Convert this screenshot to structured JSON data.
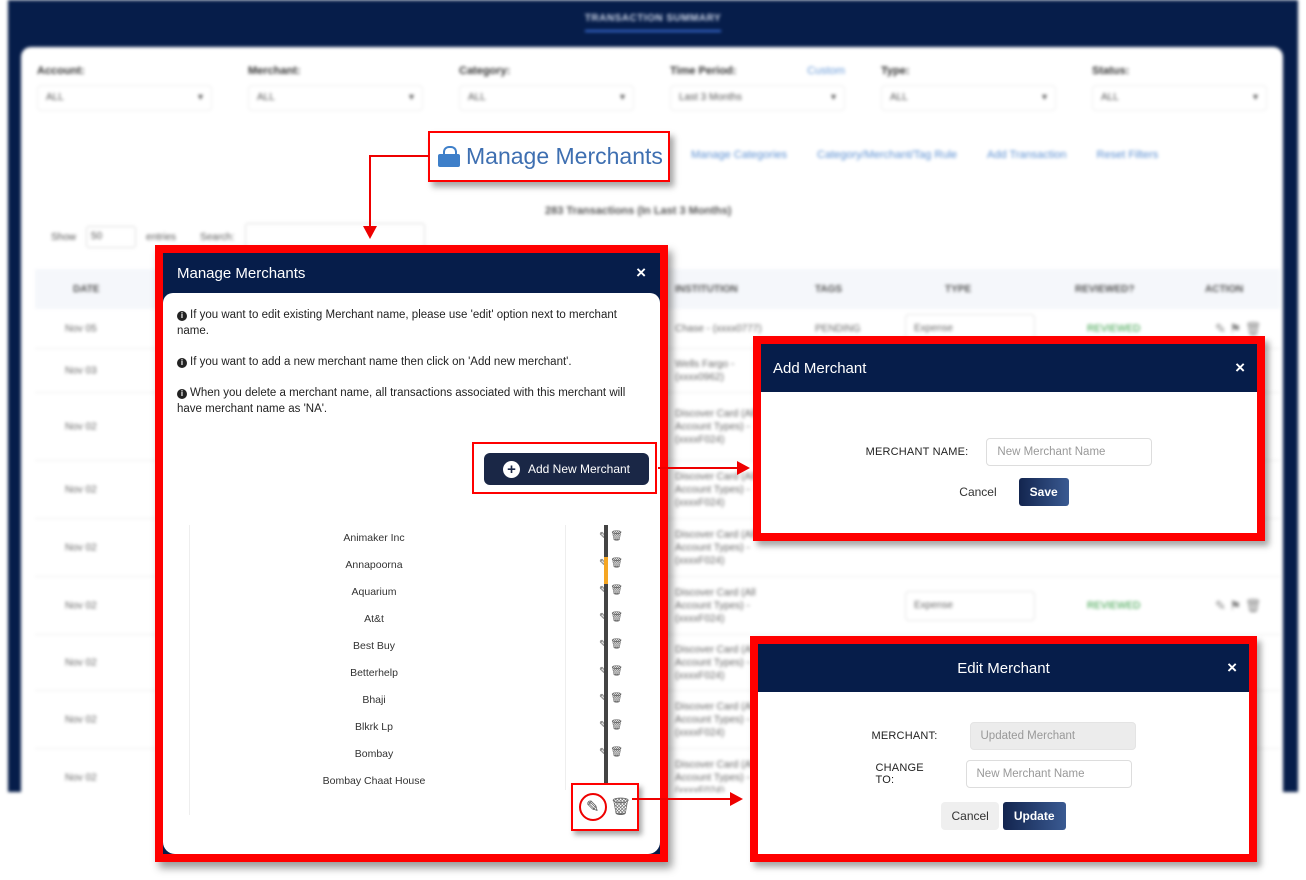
{
  "background": {
    "nav_title": "TRANSACTION SUMMARY",
    "filters": [
      {
        "label": "Account:",
        "value": "ALL"
      },
      {
        "label": "Merchant:",
        "value": "ALL"
      },
      {
        "label": "Category:",
        "value": "ALL"
      },
      {
        "label": "Time Period:",
        "value": "Last 3 Months",
        "link": "Custom"
      },
      {
        "label": "Type:",
        "value": "ALL"
      },
      {
        "label": "Status:",
        "value": "ALL"
      }
    ],
    "links": [
      "Manage Categories",
      "Category/Merchant/Tag Rule",
      "Add Transaction",
      "Reset Filters"
    ],
    "summary": "283 Transactions (In Last 3 Months)",
    "show_label": "Show",
    "show_value": "50",
    "entries_label": "entries",
    "search_label": "Search:",
    "columns": [
      "DATE",
      "INSTITUTION",
      "TAGS",
      "TYPE",
      "REVIEWED?",
      "ACTION"
    ],
    "rows": [
      {
        "date": "Nov 05",
        "institution": "Chase - (xxxx0777)",
        "tags": "PENDING",
        "type": "Expense",
        "reviewed": "REVIEWED"
      },
      {
        "date": "Nov 03",
        "institution": "Wells Fargo - (xxxx0962)",
        "tags": "",
        "type": "",
        "reviewed": ""
      },
      {
        "date": "Nov 02",
        "institution": "Discover Card (All Account Types) - (xxxxF024)",
        "tags": "",
        "type": "",
        "reviewed": ""
      },
      {
        "date": "Nov 02",
        "institution": "Discover Card (All Account Types) - (xxxxF024)",
        "tags": "",
        "type": "",
        "reviewed": ""
      },
      {
        "date": "Nov 02",
        "institution": "Discover Card (All Account Types) - (xxxxF024)",
        "tags": "",
        "type": "",
        "reviewed": ""
      },
      {
        "date": "Nov 02",
        "institution": "Discover Card (All Account Types) - (xxxxF024)",
        "tags": "",
        "type": "Expense",
        "reviewed": "REVIEWED"
      },
      {
        "date": "Nov 02",
        "institution": "Discover Card (All Account Types) - (xxxxF024)",
        "tags": "",
        "type": "",
        "reviewed": ""
      },
      {
        "date": "Nov 02",
        "institution": "Discover Card (All Account Types) - (xxxxF024)",
        "tags": "",
        "type": "",
        "reviewed": ""
      },
      {
        "date": "Nov 02",
        "institution": "Discover Card (All Account Types) - (xxxxF024)",
        "tags": "",
        "type": "",
        "reviewed": ""
      }
    ]
  },
  "manage_merchants_link": {
    "label": "Manage Merchants",
    "icon": "shopping-bag-icon"
  },
  "manage_modal": {
    "title": "Manage Merchants",
    "close": "×",
    "info": [
      "If you want to edit existing Merchant name, please use 'edit' option next to merchant name.",
      "If you want to add a new merchant name then click on 'Add new merchant'.",
      "When you delete a merchant name, all transactions associated with this merchant will have merchant name as 'NA'."
    ],
    "add_button": "Add New Merchant",
    "merchants": [
      "Animaker Inc",
      "Annapoorna",
      "Aquarium",
      "At&t",
      "Best Buy",
      "Betterhelp",
      "Bhaji",
      "Blkrk Lp",
      "Bombay",
      "Bombay Chaat House"
    ],
    "icons": {
      "edit": "✎",
      "delete": "🗑"
    }
  },
  "add_modal": {
    "title": "Add Merchant",
    "close": "×",
    "label": "MERCHANT NAME:",
    "placeholder": "New Merchant Name",
    "cancel": "Cancel",
    "save": "Save"
  },
  "edit_modal": {
    "title": "Edit Merchant",
    "close": "×",
    "merchant_label": "MERCHANT:",
    "merchant_value": "Updated Merchant",
    "change_label": "CHANGE TO:",
    "change_placeholder": "New Merchant Name",
    "cancel": "Cancel",
    "update": "Update"
  },
  "colors": {
    "navy": "#061d4a",
    "callout_red": "#ff0000",
    "link_blue": "#3e6fb1",
    "scroll_accent": "#f5a623"
  }
}
